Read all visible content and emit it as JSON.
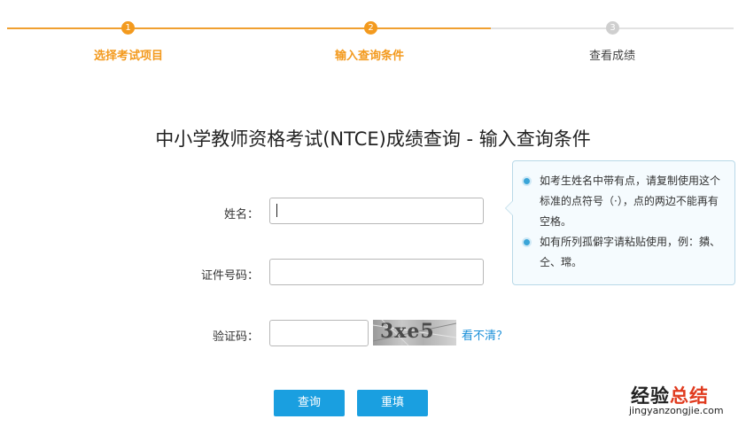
{
  "steps": [
    {
      "number": "1",
      "label": "选择考试项目",
      "state": "done"
    },
    {
      "number": "2",
      "label": "输入查询条件",
      "state": "current"
    },
    {
      "number": "3",
      "label": "查看成绩",
      "state": "pending"
    }
  ],
  "title": "中小学教师资格考试(NTCE)成绩查询 - 输入查询条件",
  "form": {
    "name_label": "姓名：",
    "name_value": "",
    "id_label": "证件号码：",
    "id_value": "",
    "captcha_label": "验证码：",
    "captcha_value": "",
    "captcha_image_text": "3xe5",
    "refresh_link": "看不清？"
  },
  "tips": [
    "如考生姓名中带有点，请复制使用这个标准的点符号（·），点的两边不能再有空格。",
    "如有所列孤僻字请粘贴使用，例：㚍、仝、瑺。"
  ],
  "buttons": {
    "query": "查询",
    "reset": "重填"
  },
  "watermark": {
    "main_part1": "经验",
    "main_part2": "总结",
    "sub": "jingyanzongjie.com"
  },
  "colors": {
    "accent_orange": "#f39a1e",
    "button_blue": "#1a9fe0",
    "link_blue": "#1a8fd8"
  }
}
